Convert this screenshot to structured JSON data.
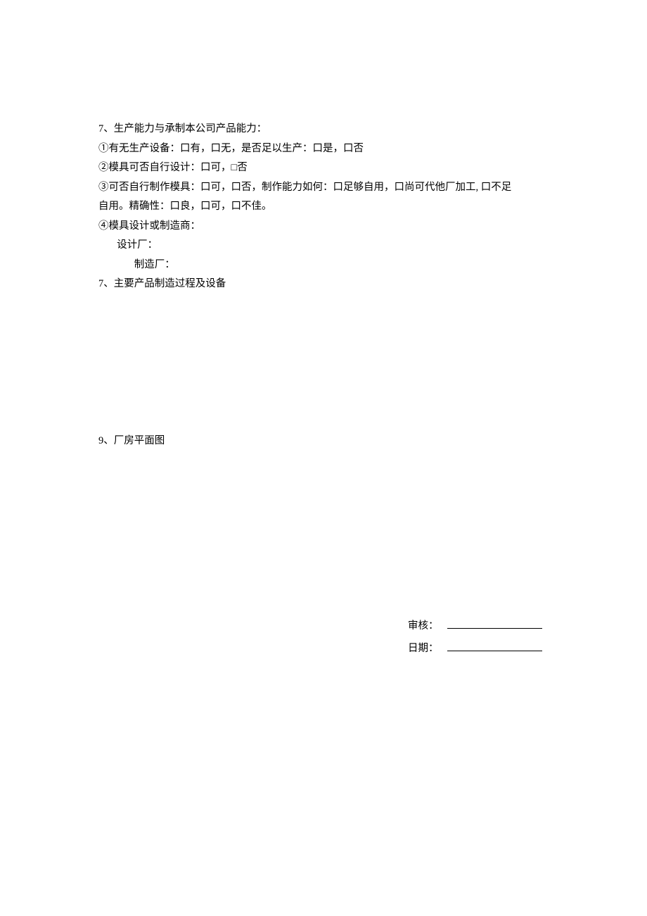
{
  "s7": {
    "title": "7、生产能力与承制本公司产品能力：",
    "q1": "①有无生产设备：口有，口无，是否足以生产：口是，口否",
    "q2": "②模具可否自行设计：口可，□否",
    "q3a": "③可否自行制作模具：口可，口否，制作能力如何：口足够自用，口尚可代他厂加工, 口不足",
    "q3b": "自用。精确性：口良，口可，口不佳。",
    "q4": "④模具设计或制造商：",
    "q4a": "设计厂：",
    "q4b": "制造厂："
  },
  "s7b": "7、主要产品制造过程及设备",
  "s9": "9、厂房平面图",
  "signature": {
    "reviewer_label": "审核：",
    "date_label": "日期："
  }
}
